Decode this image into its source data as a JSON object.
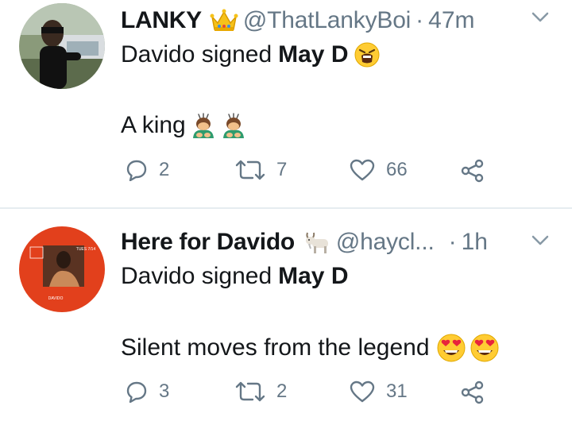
{
  "tweets": [
    {
      "name": "LANKY",
      "badge_icon": "crown-icon",
      "handle": "@ThatLankyBoi",
      "separator": "·",
      "time": "47m",
      "line1_prefix": "Davido signed",
      "line1_bold": "May D",
      "line1_emoji": "weary-face-icon",
      "line2": "A king",
      "line2_emoji": "man-bowing-icon",
      "replies": "2",
      "retweets": "7",
      "likes": "66"
    },
    {
      "name": "Here for Davido",
      "badge_icon": "goat-icon",
      "handle": "@haycl...",
      "separator": "·",
      "time": "1h",
      "line1_prefix": "Davido signed",
      "line1_bold": "May D",
      "line2": "Silent moves from the legend",
      "line2_emoji": "heart-eyes-icon",
      "avatar_text": {
        "top": "TUES 7/14",
        "bottom": "DAVIDO"
      },
      "replies": "3",
      "retweets": "2",
      "likes": "31"
    }
  ],
  "colors": {
    "text": "#14171a",
    "muted": "#657786",
    "divider": "#e6ecf0",
    "avatar2_bg": "#e2401c"
  }
}
